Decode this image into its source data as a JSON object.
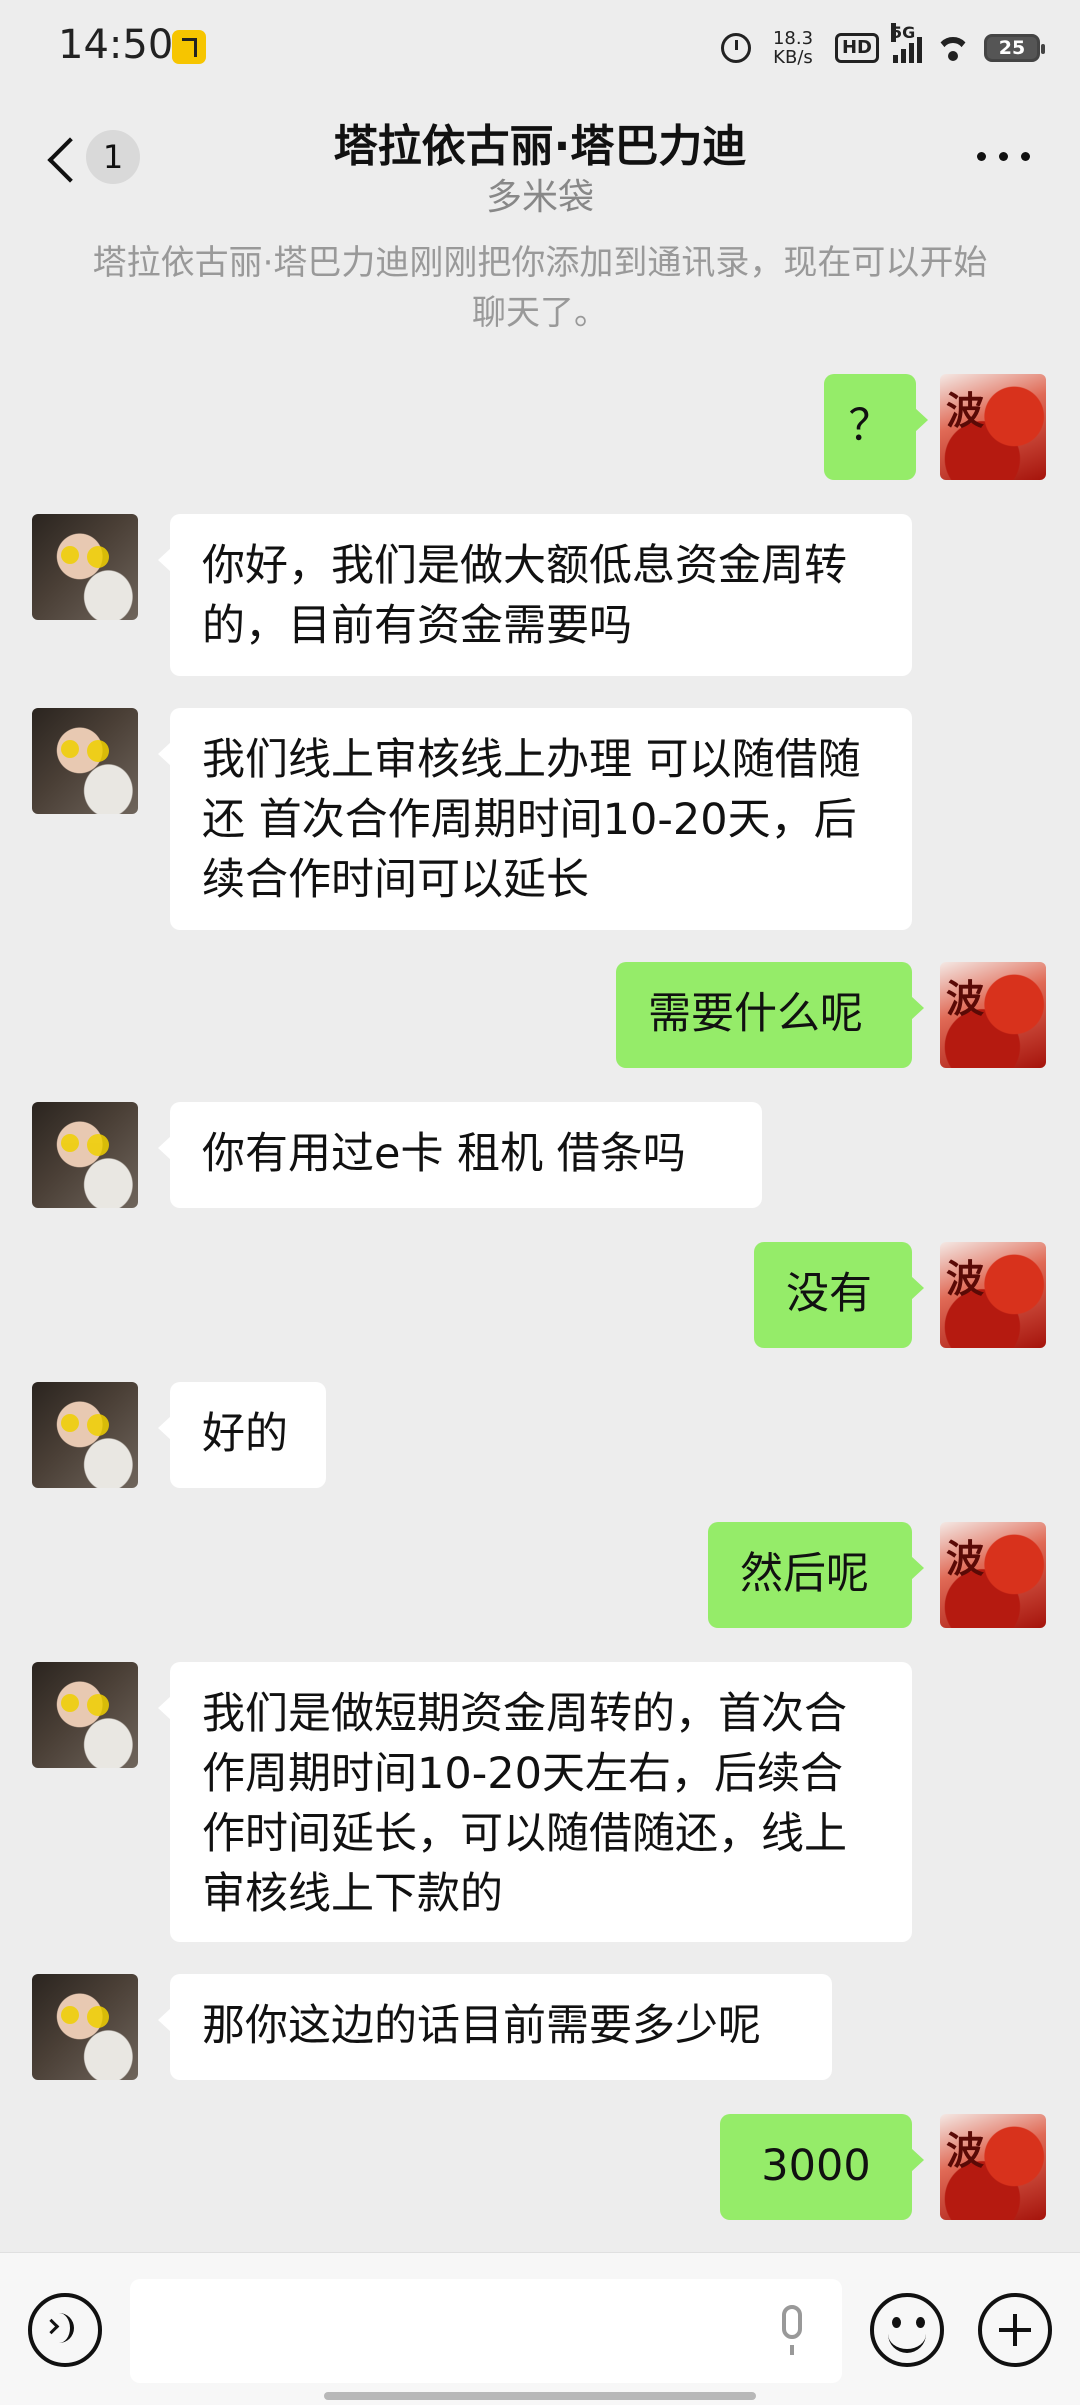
{
  "status_bar": {
    "time": "14:50",
    "net_speed_value": "18.3",
    "net_speed_unit": "KB/s",
    "hd_label": "HD",
    "network_type": "5G",
    "battery": "25"
  },
  "header": {
    "title": "塔拉依古丽·塔巴力迪",
    "subtitle": "多米袋",
    "unread_count": "1"
  },
  "system_notice": "塔拉依古丽·塔巴力迪刚刚把你添加到通讯录，现在可以开始聊天了。",
  "avatar_right_glyph": "波",
  "messages": [
    {
      "side": "right",
      "text": "？"
    },
    {
      "side": "left",
      "text": "你好，我们是做大额低息资金周转的，目前有资金需要吗"
    },
    {
      "side": "left",
      "text": "我们线上审核线上办理  可以随借随还  首次合作周期时间10-20天，后续合作时间可以延长"
    },
    {
      "side": "right",
      "text": "需要什么呢"
    },
    {
      "side": "left",
      "text": "你有用过e卡 租机 借条吗"
    },
    {
      "side": "right",
      "text": "没有"
    },
    {
      "side": "left",
      "text": "好的"
    },
    {
      "side": "right",
      "text": "然后呢"
    },
    {
      "side": "left",
      "text": "我们是做短期资金周转的，首次合作周期时间10-20天左右，后续合作时间延长，可以随借随还，线上审核线上下款的"
    },
    {
      "side": "left",
      "text": "那你这边的话目前需要多少呢"
    },
    {
      "side": "right",
      "text": "3000"
    }
  ],
  "colors": {
    "background": "#ededed",
    "bubble_sent": "#95ec69",
    "bubble_received": "#ffffff"
  }
}
